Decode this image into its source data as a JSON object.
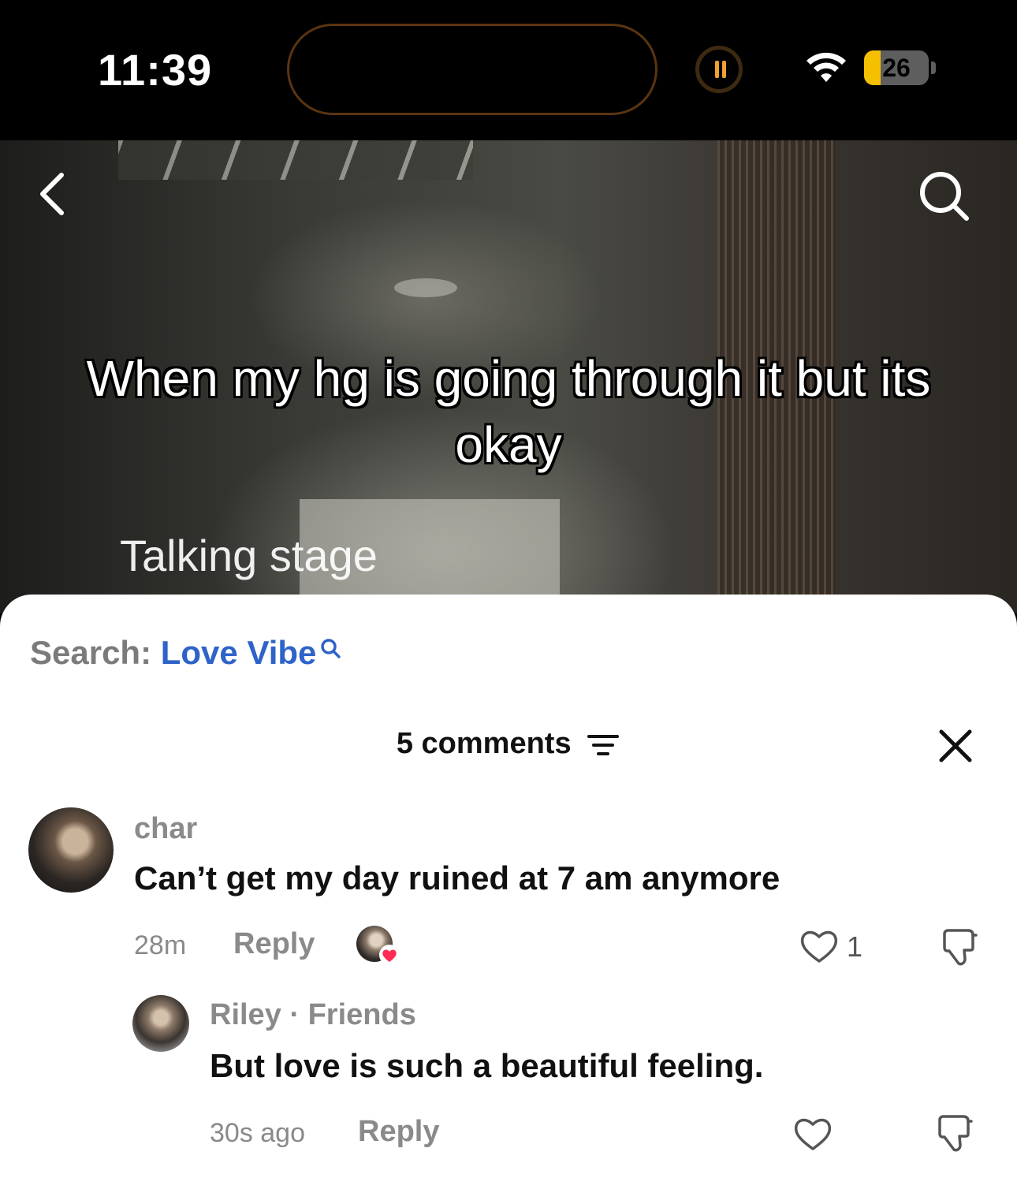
{
  "status_bar": {
    "time": "11:39",
    "battery_level": 26,
    "battery_text": "26",
    "battery_color": "#f5c000",
    "icons": [
      "pause-icon",
      "wifi-icon",
      "battery-icon"
    ]
  },
  "video": {
    "caption": "When my hg is going through it but its okay",
    "sticker_text": "Talking stage",
    "icons": [
      "chevron-left-icon",
      "search-icon"
    ]
  },
  "search_hint": {
    "label": "Search:",
    "term": "Love Vibe",
    "term_color": "#2e63c8"
  },
  "comments": {
    "title": "5 comments",
    "items": [
      {
        "username": "char",
        "text": "Can’t get my day ruined at 7 am anymore",
        "time": "28m",
        "reply_label": "Reply",
        "like_count": "1"
      }
    ],
    "replies": [
      {
        "username": "Riley · Friends",
        "text": "But love is such a beautiful feeling.",
        "time": "30s ago",
        "reply_label": "Reply"
      }
    ]
  },
  "colors": {
    "accent_heart": "#fe2c55",
    "muted_text": "#8a8a8a"
  }
}
